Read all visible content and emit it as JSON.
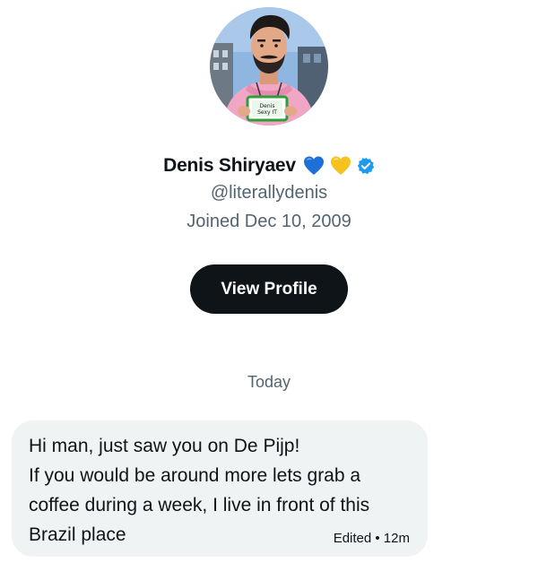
{
  "profile": {
    "display_name": "Denis Shiryaev",
    "handle": "@literallydenis",
    "joined": "Joined Dec 10, 2009",
    "badges": [
      "blue-heart-icon",
      "yellow-heart-icon",
      "verified-badge-icon"
    ],
    "avatar_badge_text": "Denis\nSexy IT",
    "view_profile_label": "View Profile"
  },
  "conversation": {
    "date_divider": "Today",
    "messages": [
      {
        "text": "Hi man, just saw you on De Pijp!\nIf you would be around more lets grab a\ncoffee during a week, I live in front of this\nBrazil place",
        "meta": "Edited • 12m"
      }
    ]
  },
  "colors": {
    "button_bg": "#0f1419",
    "secondary_text": "#536471",
    "bubble_bg": "#eff3f4",
    "verified_blue": "#1d9bf0",
    "heart_blue": "#1f6fd9",
    "heart_yellow": "#f5c220"
  }
}
